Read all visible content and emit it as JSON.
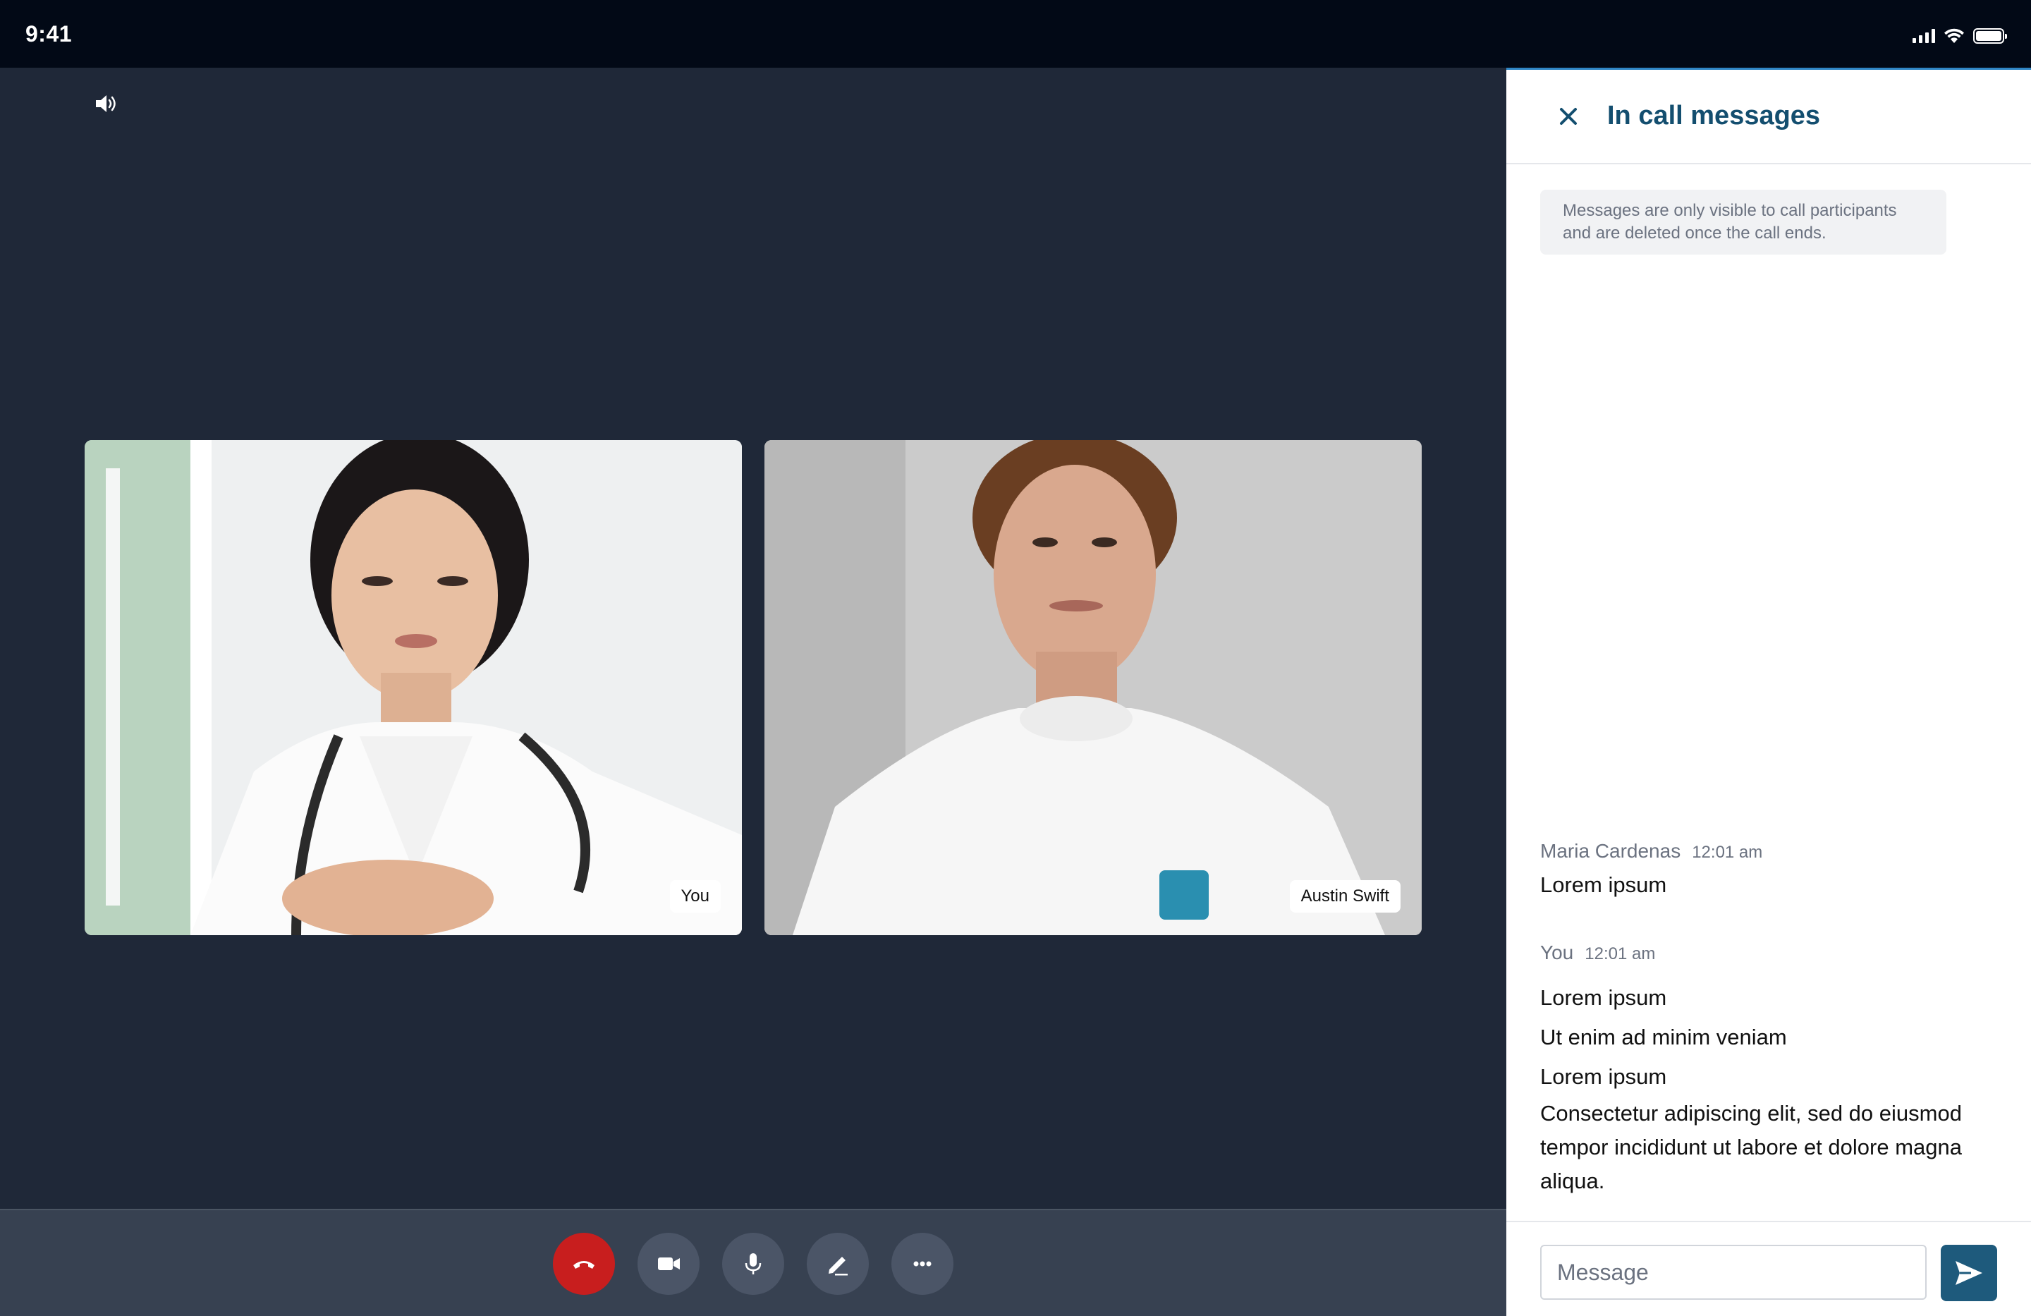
{
  "status_bar": {
    "time": "9:41",
    "icons": [
      "signal-icon",
      "wifi-icon",
      "battery-icon"
    ]
  },
  "stage": {
    "speaker_icon": "speaker-icon",
    "participants": [
      {
        "label": "You"
      },
      {
        "label": "Austin Swift"
      }
    ]
  },
  "controls": {
    "buttons": [
      "end-call-icon",
      "video-camera-icon",
      "microphone-icon",
      "pencil-icon",
      "more-icon"
    ],
    "colors": {
      "end_call": "#c81e1e",
      "button_bg": "#4b5567"
    }
  },
  "panel": {
    "title": "In call messages",
    "notice": "Messages are only visible to call participants and are deleted once the call ends.",
    "messages": [
      {
        "sender": "Maria Cardenas",
        "time": "12:01 am",
        "lines": [
          "Lorem ipsum"
        ]
      },
      {
        "sender": "You",
        "time": "12:01 am",
        "lines": [
          "Lorem ipsum",
          "Ut enim ad minim veniam",
          "Lorem ipsum",
          "Consectetur adipiscing elit, sed do eiusmod tempor incididunt ut labore et dolore magna aliqua."
        ]
      }
    ],
    "composer": {
      "placeholder": "Message"
    }
  },
  "colors": {
    "accent": "#1e5a7c",
    "title": "#134e6f",
    "stage_bg": "#1f2838"
  }
}
